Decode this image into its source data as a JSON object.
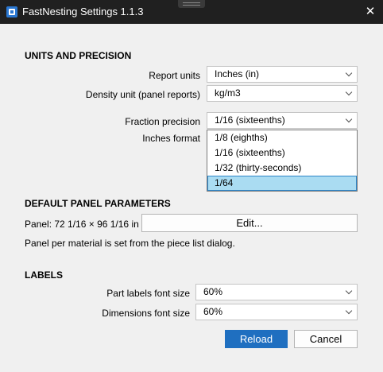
{
  "window": {
    "title": "FastNesting Settings 1.1.3",
    "close_glyph": "✕",
    "icon": "fastnesting-app-icon"
  },
  "units_precision": {
    "heading": "UNITS AND PRECISION",
    "report_units": {
      "label": "Report units",
      "value": "Inches (in)"
    },
    "density_unit": {
      "label": "Density unit (panel  reports)",
      "value": "kg/m3"
    },
    "fraction_precision": {
      "label": "Fraction precision",
      "value": "1/16 (sixteenths)",
      "options": [
        "1/8 (eighths)",
        "1/16 (sixteenths)",
        "1/32 (thirty-seconds)",
        "1/64"
      ],
      "highlighted_option": "1/64"
    },
    "inches_format": {
      "label": "Inches format"
    }
  },
  "panel_params": {
    "heading": "DEFAULT PANEL PARAMETERS",
    "panel_text": "Panel: 72 1/16 × 96 1/16 in",
    "edit_label": "Edit...",
    "note": "Panel per material is set from the piece list dialog."
  },
  "labels": {
    "heading": "LABELS",
    "part_labels": {
      "label": "Part labels font size",
      "value": "60%"
    },
    "dimensions": {
      "label": "Dimensions font size",
      "value": "60%"
    }
  },
  "actions": {
    "reload_label": "Reload",
    "cancel_label": "Cancel"
  },
  "colors": {
    "titlebar": "#202020",
    "background": "#f0f0f0",
    "primary_button": "#1f6fc0",
    "selected_option": "#aadcf2",
    "selected_option_border": "#2e86c9"
  }
}
